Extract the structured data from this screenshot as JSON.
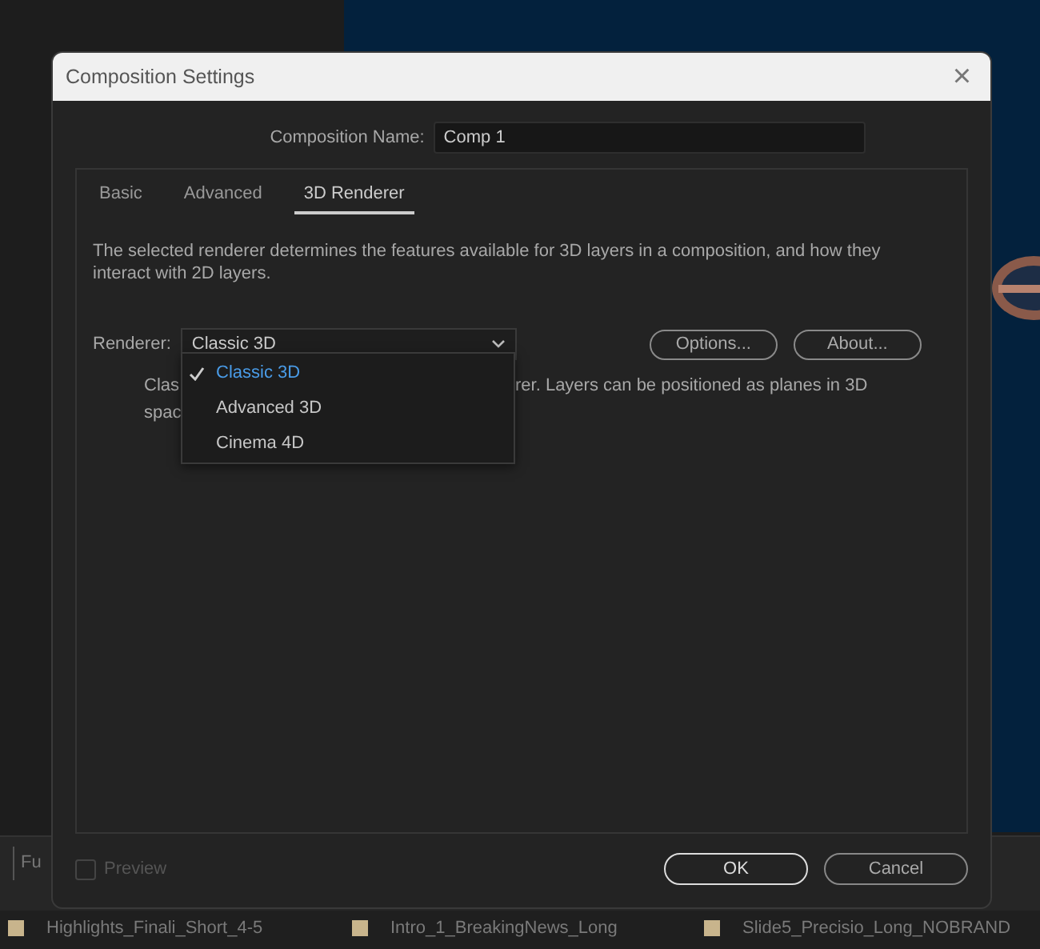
{
  "background": {
    "panel_label": "Fu",
    "files": [
      {
        "name": "Highlights_Finali_Short_4-5",
        "color": "#c8b48c"
      },
      {
        "name": "Intro_1_BreakingNews_Long",
        "color": "#c8b48c"
      },
      {
        "name": "Slide5_Precisio_Long_NOBRAND",
        "color": "#c8b48c"
      }
    ]
  },
  "dialog": {
    "title": "Composition Settings",
    "close": "×",
    "name_label": "Composition Name:",
    "name_value": "Comp 1",
    "tabs": [
      {
        "label": "Basic",
        "selected": false
      },
      {
        "label": "Advanced",
        "selected": false
      },
      {
        "label": "3D Renderer",
        "selected": true
      }
    ],
    "description": "The selected renderer determines the features available for 3D layers in a composition, and how they interact with 2D layers.",
    "renderer_label": "Renderer:",
    "renderer_value": "Classic 3D",
    "buttons": [
      "Options...",
      "About..."
    ],
    "info_left": [
      "Clas",
      "spac"
    ],
    "info_right": "rer. Layers can be positioned as planes in 3D",
    "menu": [
      {
        "label": "Classic 3D",
        "selected": true
      },
      {
        "label": "Advanced 3D",
        "selected": false
      },
      {
        "label": "Cinema 4D",
        "selected": false
      }
    ],
    "preview": {
      "label": "Preview",
      "checked": false,
      "disabled": true
    },
    "footer_buttons": [
      {
        "label": "OK",
        "kind": "primary"
      },
      {
        "label": "Cancel",
        "kind": "secondary"
      }
    ]
  }
}
